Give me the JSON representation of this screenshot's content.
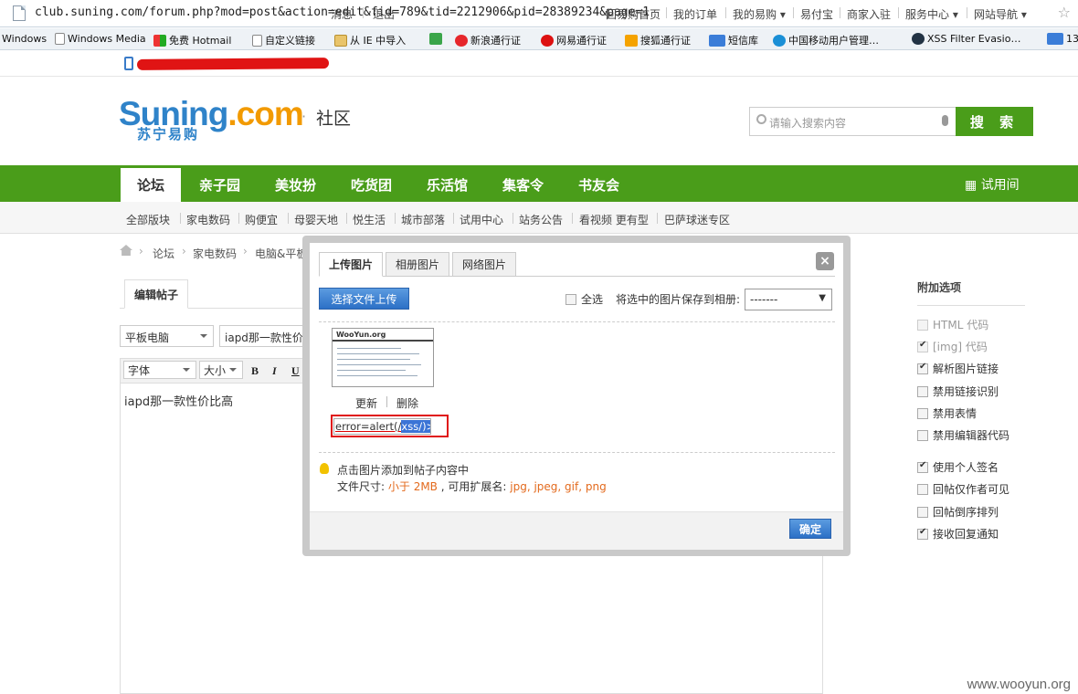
{
  "browser": {
    "url": "club.suning.com/forum.php?mod=post&action=edit&fid=789&tid=2212906&pid=28389234&page=1",
    "bookmarks": [
      {
        "label": "Windows",
        "icon": "ie-icon"
      },
      {
        "label": "Windows Media",
        "icon": "page-icon"
      },
      {
        "label": "免费 Hotmail",
        "icon": "windows-logo-icon"
      },
      {
        "label": "自定义链接",
        "icon": "page-icon"
      },
      {
        "label": "从 IE 中导入",
        "icon": "folder-icon"
      },
      {
        "label": "hao123",
        "icon": "hao-icon"
      },
      {
        "label": "新浪通行证",
        "icon": "weibo-icon"
      },
      {
        "label": "网易通行证",
        "icon": "netease-icon"
      },
      {
        "label": "搜狐通行证",
        "icon": "sohu-icon"
      },
      {
        "label": "短信库",
        "icon": "139-icon"
      },
      {
        "label": "中国移动用户管理…",
        "icon": "china-mobile-icon"
      },
      {
        "label": "XSS Filter Evasio…",
        "icon": "globe-icon"
      },
      {
        "label": "13",
        "icon": "139-icon"
      }
    ]
  },
  "topnav": {
    "left": [
      "消息",
      "退出"
    ],
    "right": [
      "回易购首页",
      "我的订单",
      "我的易购",
      "易付宝",
      "商家入驻",
      "服务中心",
      "网站导航"
    ]
  },
  "header": {
    "logo_main": "Suning",
    "logo_com": ".com",
    "logo_sub": "苏宁易购",
    "dot": "·",
    "section": "社区",
    "search_placeholder": "请输入搜索内容",
    "search_button": "搜 索"
  },
  "mainnav": {
    "items": [
      "论坛",
      "亲子园",
      "美妆扮",
      "吃货团",
      "乐活馆",
      "集客令",
      "书友会"
    ],
    "trial": "试用间"
  },
  "subnav": [
    "全部版块",
    "家电数码",
    "购便宜",
    "母婴天地",
    "悦生活",
    "城市部落",
    "试用中心",
    "站务公告",
    "看视频 更有型",
    "巴萨球迷专区"
  ],
  "breadcrumb": [
    "论坛",
    "家电数码",
    "电脑&平板"
  ],
  "editor": {
    "tab": "编辑帖子",
    "category": "平板电脑",
    "title_value": "iapd那一款性价比高",
    "font": "字体",
    "size": "大小",
    "bold": "B",
    "italic": "I",
    "underline": "U",
    "body": "iapd那一款性价比高"
  },
  "sidebar": {
    "title": "附加选项",
    "options": [
      {
        "label": "HTML 代码",
        "checked": false,
        "disabled": true
      },
      {
        "label": "[img] 代码",
        "checked": true,
        "disabled": true
      },
      {
        "label": "解析图片链接",
        "checked": true,
        "disabled": false
      },
      {
        "label": "禁用链接识别",
        "checked": false,
        "disabled": false
      },
      {
        "label": "禁用表情",
        "checked": false,
        "disabled": false
      },
      {
        "label": "禁用编辑器代码",
        "checked": false,
        "disabled": false
      },
      {
        "label": "使用个人签名",
        "checked": true,
        "disabled": false
      },
      {
        "label": "回帖仅作者可见",
        "checked": false,
        "disabled": false
      },
      {
        "label": "回帖倒序排列",
        "checked": false,
        "disabled": false
      },
      {
        "label": "接收回复通知",
        "checked": true,
        "disabled": false
      }
    ]
  },
  "modal": {
    "tabs": [
      "上传图片",
      "相册图片",
      "网络图片"
    ],
    "close": "×",
    "choose_button": "选择文件上传",
    "select_all": "全选",
    "save_label": "将选中的图片保存到相册:",
    "album_value": "-------",
    "thumb_logo": "WooYun.org",
    "update": "更新",
    "delete": "删除",
    "desc_value": {
      "pre": "error=alert(/",
      "hl": "xss/)>"
    },
    "hint_line1": "点击图片添加到帖子内容中",
    "hint_size_label": "文件尺寸:",
    "hint_size_value": "小于 2MB",
    "hint_ext_label": ", 可用扩展名:",
    "hint_ext_value": "jpg, jpeg, gif, png",
    "ok": "确定"
  },
  "watermark": "www.wooyun.org",
  "colors": {
    "brand_green": "#4a9d1a",
    "logo_blue": "#2f83c9",
    "logo_orange": "#f29a00",
    "accent_red": "#e01414",
    "button_blue": "#2c70c6"
  }
}
